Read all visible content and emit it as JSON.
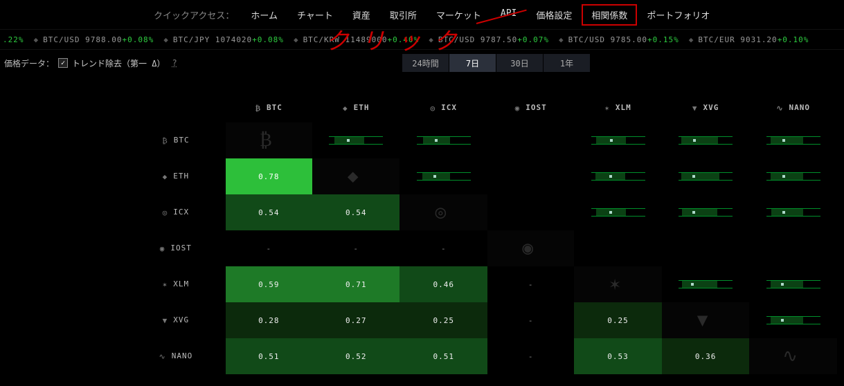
{
  "nav": {
    "quick_label": "クイックアクセス：",
    "items": [
      "ホーム",
      "チャート",
      "資産",
      "取引所",
      "マーケット",
      "API",
      "価格設定",
      "相関係数",
      "ポートフォリオ"
    ],
    "highlight_index": 7
  },
  "annotation": {
    "text": "クリック"
  },
  "ticker": [
    {
      "pair": "",
      "price": ".22%",
      "change": "",
      "lead_green": true
    },
    {
      "pair": "BTC/USD",
      "price": "9788.00",
      "change": "+0.08%"
    },
    {
      "pair": "BTC/JPY",
      "price": "1074020",
      "change": "+0.08%"
    },
    {
      "pair": "BTC/KRW",
      "price": "11489000",
      "change": "+0.40%"
    },
    {
      "pair": "BTC/USD",
      "price": "9787.50",
      "change": "+0.07%"
    },
    {
      "pair": "BTC/USD",
      "price": "9785.00",
      "change": "+0.15%"
    },
    {
      "pair": "BTC/EUR",
      "price": "9031.20",
      "change": "+0.10%"
    }
  ],
  "filter": {
    "price_label": "価格データ：",
    "checkbox_checked": true,
    "trend_label": "トレンド除去（第一 Δ）",
    "help": "?",
    "periods": [
      "24時間",
      "7日",
      "30日",
      "1年"
    ],
    "active_period": 1
  },
  "coins": [
    {
      "sym": "BTC",
      "icon": "₿"
    },
    {
      "sym": "ETH",
      "icon": "◆"
    },
    {
      "sym": "ICX",
      "icon": "◎"
    },
    {
      "sym": "IOST",
      "icon": "◉"
    },
    {
      "sym": "XLM",
      "icon": "✶"
    },
    {
      "sym": "XVG",
      "icon": "▼"
    },
    {
      "sym": "NANO",
      "icon": "∿"
    }
  ],
  "matrix": {
    "rows": [
      {
        "sym": "BTC",
        "vals": [
          null,
          null,
          null,
          null,
          null,
          null,
          null
        ]
      },
      {
        "sym": "ETH",
        "vals": [
          0.78,
          null,
          null,
          null,
          null,
          null,
          null
        ]
      },
      {
        "sym": "ICX",
        "vals": [
          0.54,
          0.54,
          null,
          null,
          null,
          null,
          null
        ]
      },
      {
        "sym": "IOST",
        "vals": [
          "-",
          "-",
          "-",
          null,
          null,
          null,
          null
        ]
      },
      {
        "sym": "XLM",
        "vals": [
          0.59,
          0.71,
          0.46,
          "-",
          null,
          null,
          null
        ]
      },
      {
        "sym": "XVG",
        "vals": [
          0.28,
          0.27,
          0.25,
          "-",
          0.25,
          null,
          null
        ]
      },
      {
        "sym": "NANO",
        "vals": [
          0.51,
          0.52,
          0.51,
          "-",
          0.53,
          0.36,
          null
        ]
      }
    ],
    "upper": {
      "0": {
        "1": [
          10,
          55,
          36
        ],
        "2": [
          12,
          50,
          36
        ],
        "3": null,
        "4": [
          10,
          55,
          38
        ],
        "5": [
          5,
          68,
          30
        ],
        "6": [
          8,
          60,
          32
        ]
      },
      "1": {
        "2": [
          10,
          52,
          34
        ],
        "3": null,
        "4": [
          8,
          55,
          36
        ],
        "5": [
          5,
          70,
          28
        ],
        "6": [
          8,
          60,
          32
        ]
      },
      "2": {
        "3": null,
        "4": [
          10,
          55,
          36
        ],
        "5": [
          6,
          66,
          28
        ],
        "6": [
          10,
          58,
          32
        ]
      },
      "3": {
        "4": null,
        "5": null,
        "6": null
      },
      "4": {
        "5": [
          6,
          66,
          26
        ],
        "6": [
          8,
          60,
          30
        ]
      },
      "5": {
        "6": [
          8,
          60,
          30
        ]
      }
    }
  },
  "chart_data": {
    "type": "heatmap",
    "title": "相関係数",
    "xlabel": "",
    "ylabel": "",
    "categories": [
      "BTC",
      "ETH",
      "ICX",
      "IOST",
      "XLM",
      "XVG",
      "NANO"
    ],
    "series": [
      {
        "name": "BTC",
        "values": [
          null,
          0.78,
          0.54,
          null,
          0.59,
          0.28,
          0.51
        ]
      },
      {
        "name": "ETH",
        "values": [
          0.78,
          null,
          0.54,
          null,
          0.71,
          0.27,
          0.52
        ]
      },
      {
        "name": "ICX",
        "values": [
          0.54,
          0.54,
          null,
          null,
          0.46,
          0.25,
          0.51
        ]
      },
      {
        "name": "IOST",
        "values": [
          null,
          null,
          null,
          null,
          null,
          null,
          null
        ]
      },
      {
        "name": "XLM",
        "values": [
          0.59,
          0.71,
          0.46,
          null,
          null,
          0.25,
          0.53
        ]
      },
      {
        "name": "XVG",
        "values": [
          0.28,
          0.27,
          0.25,
          null,
          0.25,
          null,
          0.36
        ]
      },
      {
        "name": "NANO",
        "values": [
          0.51,
          0.52,
          0.51,
          null,
          0.53,
          0.36,
          null
        ]
      }
    ],
    "value_range": [
      0,
      1
    ]
  }
}
